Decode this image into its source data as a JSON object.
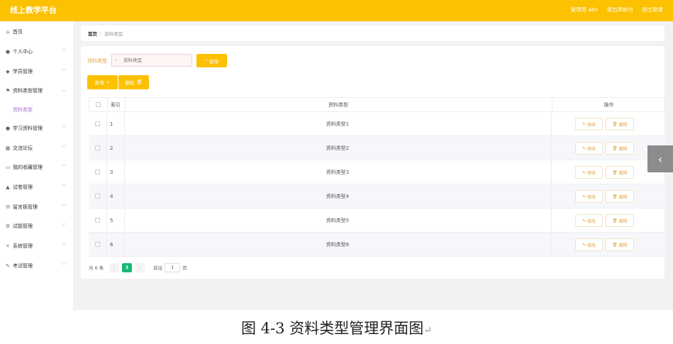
{
  "header": {
    "app_title": "线上教学平台",
    "nav": [
      "管理员 abo",
      "退出到前台",
      "退出登录"
    ]
  },
  "sidebar": {
    "items": [
      {
        "label": "首页",
        "icon": "home-icon"
      },
      {
        "label": "个人中心",
        "icon": "user-icon"
      },
      {
        "label": "学员管理",
        "icon": "student-icon"
      },
      {
        "label": "资料类型管理",
        "icon": "flag-icon"
      },
      {
        "label": "学习资料管理",
        "icon": "user-icon"
      },
      {
        "label": "交流论坛",
        "icon": "grid-icon"
      },
      {
        "label": "我的收藏管理",
        "icon": "bookmark-icon"
      },
      {
        "label": "试卷管理",
        "icon": "chart-icon"
      },
      {
        "label": "留言板管理",
        "icon": "mail-icon"
      },
      {
        "label": "试题管理",
        "icon": "gear-icon"
      },
      {
        "label": "系统管理",
        "icon": "crop-icon"
      },
      {
        "label": "考试管理",
        "icon": "exam-icon"
      }
    ],
    "active_sub": "资料类型"
  },
  "breadcrumb": {
    "home": "首页",
    "separator": "/",
    "current": "资料类型"
  },
  "search": {
    "label": "资料类型",
    "placeholder": "资料类型",
    "button": "查询"
  },
  "toolbar": {
    "add": "新增",
    "delete": "删除"
  },
  "table": {
    "headers": {
      "index": "索引",
      "type": "资料类型",
      "actions": "操作"
    },
    "rows": [
      {
        "index": "1",
        "type": "资料类型1"
      },
      {
        "index": "2",
        "type": "资料类型2"
      },
      {
        "index": "3",
        "type": "资料类型3"
      },
      {
        "index": "4",
        "type": "资料类型4"
      },
      {
        "index": "5",
        "type": "资料类型5"
      },
      {
        "index": "6",
        "type": "资料类型6"
      }
    ],
    "edit_label": "修改",
    "delete_label": "删除"
  },
  "pagination": {
    "total": "共 6 条",
    "current_page": "1",
    "goto_label": "前往",
    "goto_value": "1",
    "page_suffix": "页"
  },
  "caption": "图 4-3 资料类型管理界面图",
  "colors": {
    "accent": "#fcc100",
    "active_page": "#17b978",
    "sub_active": "#b070d0"
  }
}
